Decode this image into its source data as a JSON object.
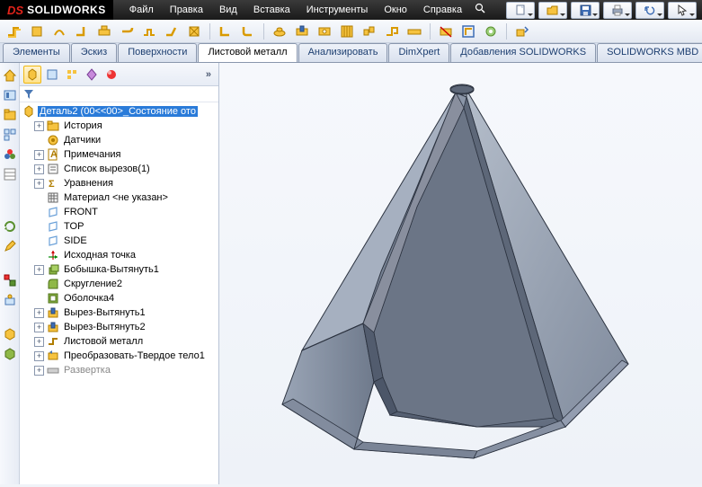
{
  "app": {
    "logo_prefix": "DS",
    "logo_name": "SOLIDWORKS"
  },
  "menu": [
    "Файл",
    "Правка",
    "Вид",
    "Вставка",
    "Инструменты",
    "Окно",
    "Справка"
  ],
  "tabs": [
    {
      "label": "Элементы",
      "active": false
    },
    {
      "label": "Эскиз",
      "active": false
    },
    {
      "label": "Поверхности",
      "active": false
    },
    {
      "label": "Листовой металл",
      "active": true
    },
    {
      "label": "Анализировать",
      "active": false
    },
    {
      "label": "DimXpert",
      "active": false
    },
    {
      "label": "Добавления SOLIDWORKS",
      "active": false
    },
    {
      "label": "SOLIDWORKS MBD",
      "active": false
    }
  ],
  "tree": {
    "root": "Деталь2  (00<<00>_Состояние ото",
    "items": [
      {
        "label": "История",
        "icon": "folder",
        "exp": "+",
        "dim": false
      },
      {
        "label": "Датчики",
        "icon": "sensor",
        "exp": "",
        "dim": false
      },
      {
        "label": "Примечания",
        "icon": "note",
        "exp": "+",
        "dim": false
      },
      {
        "label": "Список вырезов(1)",
        "icon": "cutlist",
        "exp": "+",
        "dim": false
      },
      {
        "label": "Уравнения",
        "icon": "eq",
        "exp": "+",
        "dim": false
      },
      {
        "label": "Материал <не указан>",
        "icon": "material",
        "exp": "",
        "dim": false
      },
      {
        "label": "FRONT",
        "icon": "plane",
        "exp": "",
        "dim": false
      },
      {
        "label": "TOP",
        "icon": "plane",
        "exp": "",
        "dim": false
      },
      {
        "label": "SIDE",
        "icon": "plane",
        "exp": "",
        "dim": false
      },
      {
        "label": "Исходная точка",
        "icon": "origin",
        "exp": "",
        "dim": false
      },
      {
        "label": "Бобышка-Вытянуть1",
        "icon": "extrude",
        "exp": "+",
        "dim": false
      },
      {
        "label": "Скругление2",
        "icon": "fillet",
        "exp": "",
        "dim": false
      },
      {
        "label": "Оболочка4",
        "icon": "shell",
        "exp": "",
        "dim": false
      },
      {
        "label": "Вырез-Вытянуть1",
        "icon": "cut",
        "exp": "+",
        "dim": false
      },
      {
        "label": "Вырез-Вытянуть2",
        "icon": "cut",
        "exp": "+",
        "dim": false
      },
      {
        "label": "Листовой металл",
        "icon": "sheet",
        "exp": "+",
        "dim": false
      },
      {
        "label": "Преобразовать-Твердое тело1",
        "icon": "convert",
        "exp": "+",
        "dim": false
      },
      {
        "label": "Развертка",
        "icon": "flat",
        "exp": "+",
        "dim": true
      }
    ]
  }
}
